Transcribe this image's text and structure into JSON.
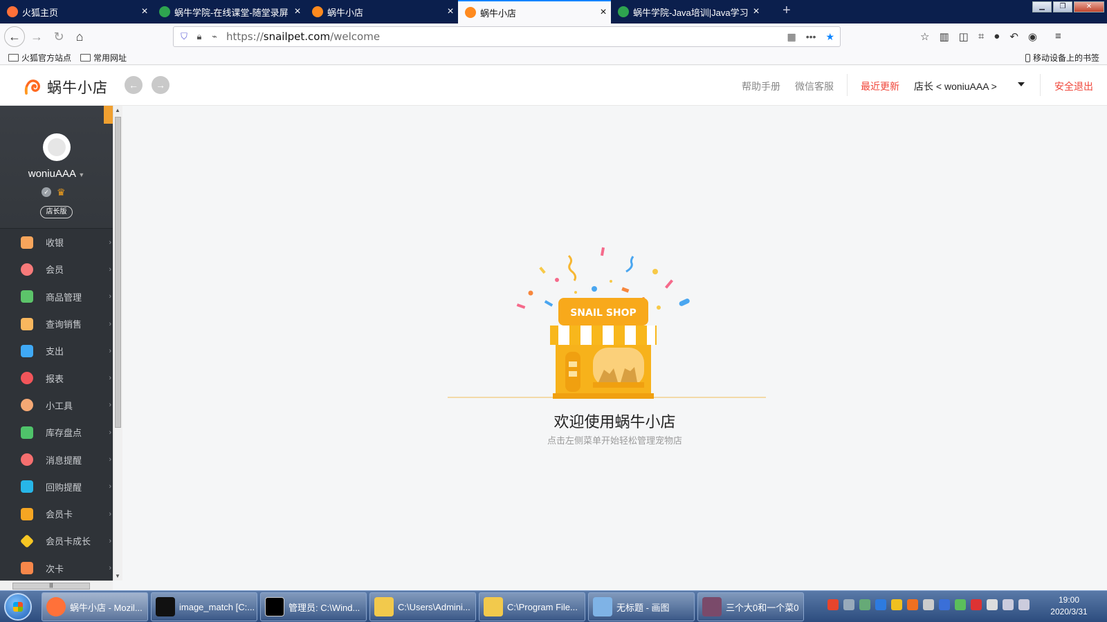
{
  "browser": {
    "tabs": [
      {
        "title": "火狐主页",
        "active": false,
        "favicon_color": "#ff7139"
      },
      {
        "title": "蜗牛学院-在线课堂-随堂录屏",
        "active": false,
        "favicon_color": "#2ea44f"
      },
      {
        "title": "蜗牛小店",
        "active": false,
        "favicon_color": "#ff8a1e"
      },
      {
        "title": "蜗牛小店",
        "active": true,
        "favicon_color": "#ff8a1e"
      },
      {
        "title": "蜗牛学院-Java培训|Java学习|V",
        "active": false,
        "favicon_color": "#2ea44f"
      }
    ],
    "url_prefix": "https://",
    "url_host": "snailpet.com",
    "url_path": "/welcome",
    "bookmarks": [
      "火狐官方站点",
      "常用网址"
    ],
    "mobile_bookmarks": "移动设备上的书签"
  },
  "header": {
    "logo_text": "蜗牛小店",
    "help_manual": "帮助手册",
    "wechat_service": "微信客服",
    "recent_updates": "最近更新",
    "user_label": "店长 < woniuAAA >",
    "logout": "安全退出"
  },
  "sidebar": {
    "username": "woniuAAA",
    "edition": "店长版",
    "items": [
      {
        "label": "收银",
        "color": "#f8a55c"
      },
      {
        "label": "会员",
        "color": "#f77a7a"
      },
      {
        "label": "商品管理",
        "color": "#5cc46a"
      },
      {
        "label": "查询销售",
        "color": "#f9b75e"
      },
      {
        "label": "支出",
        "color": "#3fa9f5"
      },
      {
        "label": "报表",
        "color": "#f2555a"
      },
      {
        "label": "小工具",
        "color": "#f5a874"
      },
      {
        "label": "库存盘点",
        "color": "#4fc36a"
      },
      {
        "label": "消息提醒",
        "color": "#f66f6f"
      },
      {
        "label": "回购提醒",
        "color": "#27b6e8"
      },
      {
        "label": "会员卡",
        "color": "#f6a623"
      },
      {
        "label": "会员卡成长",
        "color": "#f6c623"
      },
      {
        "label": "次卡",
        "color": "#f7874a"
      }
    ]
  },
  "main": {
    "welcome_title": "欢迎使用蜗牛小店",
    "welcome_subtitle": "点击左侧菜单开始轻松管理宠物店",
    "sign_text": "SNAIL SHOP"
  },
  "taskbar": {
    "tasks": [
      {
        "label": "蜗牛小店 - Mozil...",
        "color": "#ff7139",
        "active": true
      },
      {
        "label": "image_match [C:...",
        "color": "#111111",
        "active": false
      },
      {
        "label": "管理员: C:\\Wind...",
        "color": "#000000",
        "active": false
      },
      {
        "label": "C:\\Users\\Admini...",
        "color": "#f2c94c",
        "active": false
      },
      {
        "label": "C:\\Program File...",
        "color": "#f2c94c",
        "active": false
      },
      {
        "label": "无标题 - 画图",
        "color": "#7fb3e6",
        "active": false
      },
      {
        "label": "三个大0和一个菜0",
        "color": "#7a4a6a",
        "active": false
      }
    ],
    "time": "19:00",
    "date": "2020/3/31"
  }
}
